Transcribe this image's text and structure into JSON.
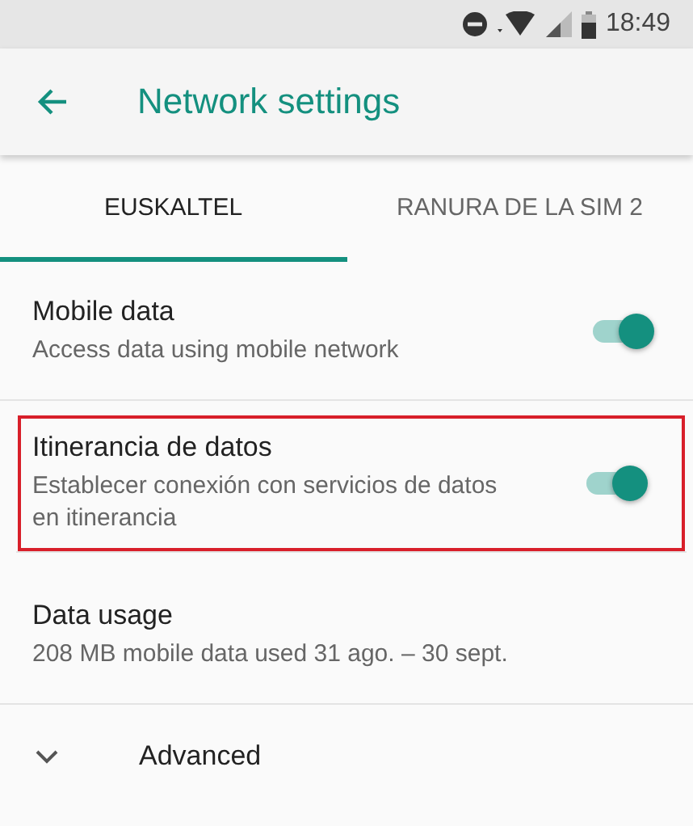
{
  "status_bar": {
    "time": "18:49"
  },
  "app_bar": {
    "title": "Network settings"
  },
  "tabs": [
    {
      "label": "EUSKALTEL",
      "selected": true
    },
    {
      "label": "RANURA DE LA SIM 2",
      "selected": false
    }
  ],
  "settings": [
    {
      "kind": "toggle",
      "title": "Mobile data",
      "summary": "Access data using mobile network",
      "on": true,
      "highlighted": false
    },
    {
      "kind": "toggle",
      "title": "Itinerancia de datos",
      "summary": "Establecer conexión con servicios de datos en itinerancia",
      "on": true,
      "highlighted": true
    },
    {
      "kind": "info",
      "title": "Data usage",
      "summary": "208 MB mobile data used 31 ago. – 30 sept."
    },
    {
      "kind": "expander",
      "title": "Advanced",
      "expanded": false
    }
  ]
}
